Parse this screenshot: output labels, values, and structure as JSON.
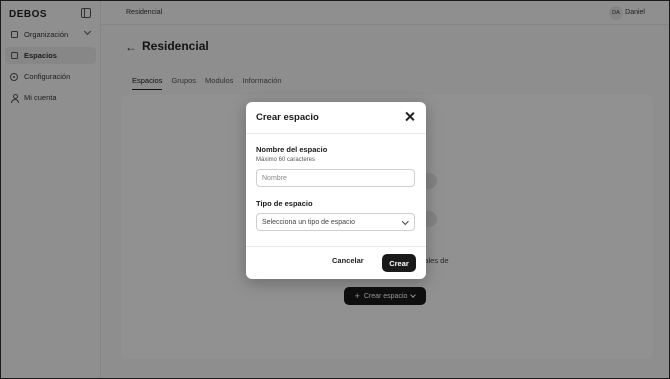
{
  "app": {
    "brand": "DEBOS"
  },
  "sidebar": {
    "items": [
      {
        "label": "Organización",
        "icon": "box-icon"
      },
      {
        "label": "Espacios",
        "icon": "box-icon"
      },
      {
        "label": "Configuración",
        "icon": "gear-icon"
      },
      {
        "label": "Mi cuenta",
        "icon": "user-icon"
      }
    ]
  },
  "header": {
    "breadcrumb": "Residencial",
    "avatar_initials": "DA",
    "user_name": "Daniel"
  },
  "main": {
    "title": "Residencial",
    "tabs": [
      {
        "label": "Espacios"
      },
      {
        "label": "Grupos"
      },
      {
        "label": "Modulos"
      },
      {
        "label": "Información"
      }
    ],
    "empty_text": "onales de",
    "create_label": "Crear espacio"
  },
  "modal": {
    "title": "Crear espacio",
    "name_label": "Nombre del espacio",
    "name_hint": "Máximo 60 caracteres",
    "name_placeholder": "Nombre",
    "name_value": "",
    "type_label": "Tipo de espacio",
    "type_selected": "Selecciona un tipo de espacio",
    "cancel_label": "Cancelar",
    "submit_label": "Crear"
  },
  "colors": {
    "accent": "#1a1a1a",
    "overlay": "rgba(0,0,0,0.42)",
    "background": "#f4f4f4"
  }
}
